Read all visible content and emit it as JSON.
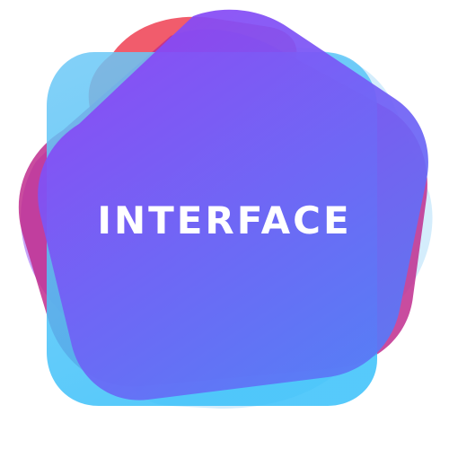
{
  "logo": {
    "text": "INTERFACE",
    "text_color": "#ffffff",
    "colors": {
      "red": "#f04a5c",
      "magenta": "#c02d8e",
      "violet": "#8c45f5",
      "lavender": "#b88cf6",
      "sky": "#6ec8f6",
      "cyan": "#38c0fa",
      "blue": "#5a78f6",
      "pale_blue": "#c6e7fb"
    }
  }
}
